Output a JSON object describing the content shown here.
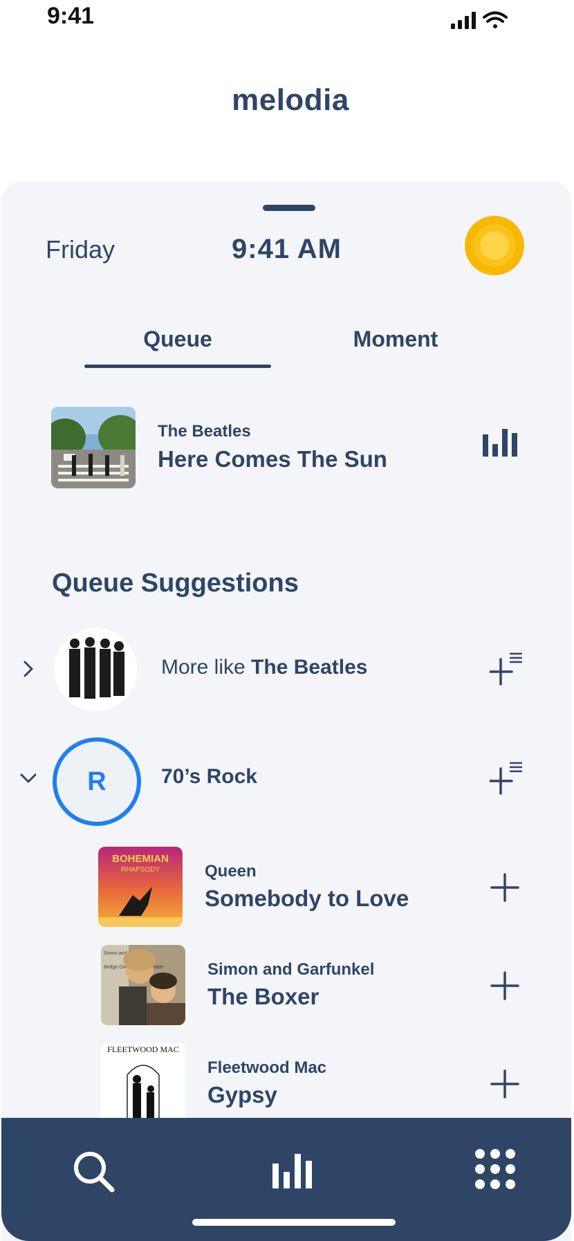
{
  "status_bar": {
    "time": "9:41"
  },
  "app": {
    "title": "melodia"
  },
  "header": {
    "day": "Friday",
    "time": "9:41 AM"
  },
  "tabs": [
    {
      "label": "Queue",
      "active": true
    },
    {
      "label": "Moment",
      "active": false
    }
  ],
  "now_playing": {
    "artist": "The Beatles",
    "title": "Here Comes The Sun"
  },
  "suggestions": {
    "heading": "Queue Suggestions",
    "more_like": {
      "prefix": "More like ",
      "artist": "The Beatles"
    },
    "playlist": {
      "initial": "R",
      "label": "70’s Rock"
    },
    "tracks": [
      {
        "artist": "Queen",
        "title": "Somebody to Love",
        "art_text_1": "BOHEMIAN",
        "art_text_2": "RHAPSODY"
      },
      {
        "artist": "Simon and Garfunkel",
        "title": "The Boxer",
        "art_text_1": "Simon and Garfunkel",
        "art_text_2": "Bridge Over Troubled Water"
      },
      {
        "artist": "Fleetwood Mac",
        "title": "Gypsy",
        "art_text_1": "FLEETWOOD MAC",
        "art_text_2": ""
      }
    ]
  },
  "colors": {
    "primary": "#2f4566",
    "accent": "#1f7ff0",
    "sun": "#f9b800",
    "sheet": "#f3f5f9"
  },
  "icons": [
    "signal-icon",
    "wifi-icon",
    "sun-icon",
    "equalizer-icon",
    "chevron-right-icon",
    "chevron-down-icon",
    "add-to-queue-icon",
    "plus-icon",
    "search-icon",
    "stats-icon",
    "apps-grid-icon"
  ]
}
